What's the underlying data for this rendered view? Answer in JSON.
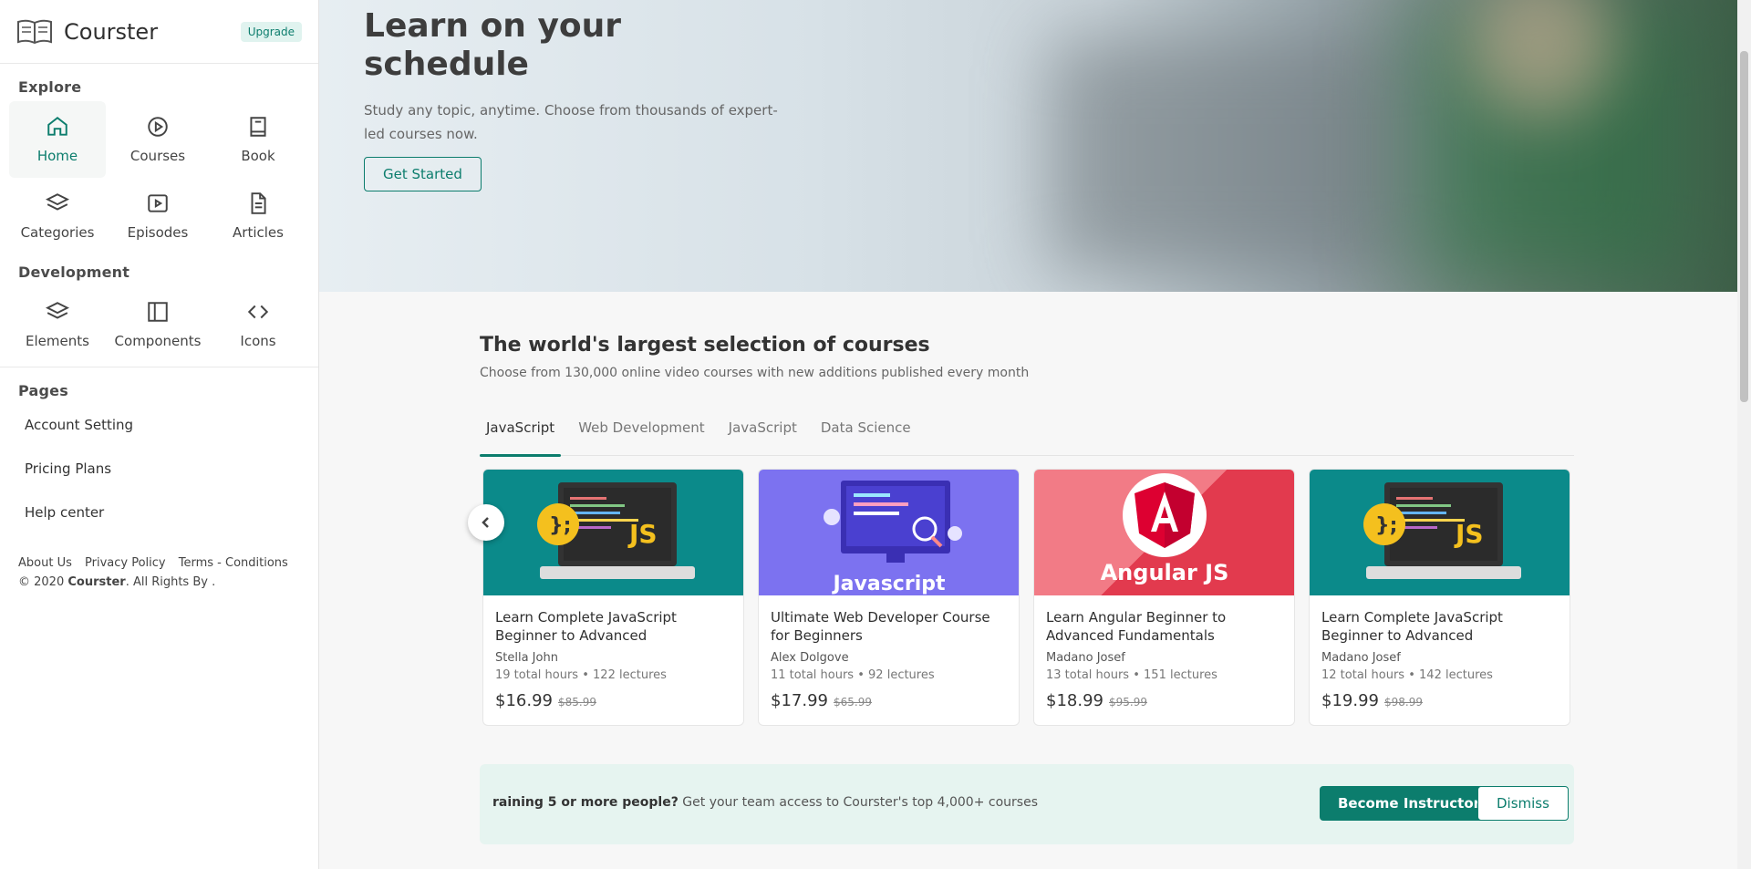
{
  "brand": {
    "name": "Courster",
    "upgrade_label": "Upgrade"
  },
  "sidebar": {
    "explore_title": "Explore",
    "explore": [
      {
        "label": "Home",
        "icon": "home-icon",
        "active": true
      },
      {
        "label": "Courses",
        "icon": "play-circle-icon"
      },
      {
        "label": "Book",
        "icon": "book-icon"
      },
      {
        "label": "Categories",
        "icon": "layers-icon"
      },
      {
        "label": "Episodes",
        "icon": "video-icon"
      },
      {
        "label": "Articles",
        "icon": "file-text-icon"
      }
    ],
    "development_title": "Development",
    "development": [
      {
        "label": "Elements",
        "icon": "layers-icon"
      },
      {
        "label": "Components",
        "icon": "layout-icon"
      },
      {
        "label": "Icons",
        "icon": "code-icon"
      }
    ],
    "pages_title": "Pages",
    "pages": [
      "Account Setting",
      "Pricing Plans",
      "Help center"
    ],
    "footer_links": [
      "About Us",
      "Privacy Policy",
      "Terms - Conditions"
    ],
    "copyright_prefix": "© 2020",
    "copyright_brand": "Courster",
    "copyright_suffix": ". All Rights By ."
  },
  "hero": {
    "title": "Learn on your schedule",
    "description": "Study any topic, anytime. Choose from thousands of expert-led courses now.",
    "cta": "Get Started"
  },
  "courses_section": {
    "title": "The world's largest selection of courses",
    "subtitle": "Choose from 130,000 online video courses with new additions published every month",
    "tabs": [
      "JavaScript",
      "Web Development",
      "JavaScript",
      "Data Science"
    ]
  },
  "courses": [
    {
      "title": "Learn Complete JavaScript Beginner to Advanced",
      "author": "Stella John",
      "hours": "19 total hours",
      "lectures": "122 lectures",
      "price": "$16.99",
      "old_price": "$85.99",
      "thumb": "js"
    },
    {
      "title": "Ultimate Web Developer Course for Beginners",
      "author": "Alex Dolgove",
      "hours": "11 total hours",
      "lectures": "92 lectures",
      "price": "$17.99",
      "old_price": "$65.99",
      "thumb": "javascript",
      "thumb_label": "Javascript"
    },
    {
      "title": "Learn Angular Beginner to Advanced Fundamentals",
      "author": "Madano Josef",
      "hours": "13 total hours",
      "lectures": "151 lectures",
      "price": "$18.99",
      "old_price": "$95.99",
      "thumb": "angular",
      "thumb_label": "Angular JS"
    },
    {
      "title": "Learn Complete JavaScript Beginner to Advanced",
      "author": "Madano Josef",
      "hours": "12 total hours",
      "lectures": "142 lectures",
      "price": "$19.99",
      "old_price": "$98.99",
      "thumb": "js"
    }
  ],
  "js_thumb_label": "JS",
  "banner": {
    "bold": "raining 5 or more people?",
    "text": " Get your team access to Courster's top 4,000+ courses",
    "primary": "Become Instructor",
    "dismiss": "Dismiss"
  },
  "colors": {
    "accent": "#0c7d6d",
    "teal_thumb": "#0b8a8a",
    "purple_thumb": "#7c72f0",
    "red_thumb": "#e23a4e"
  }
}
